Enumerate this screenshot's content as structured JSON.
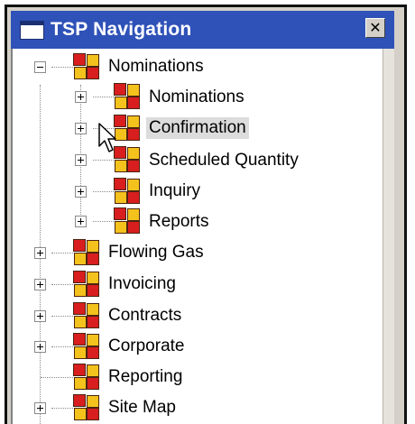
{
  "window": {
    "title": "TSP Navigation",
    "close_glyph": "✕"
  },
  "tree": {
    "root": {
      "label": "Nominations",
      "children": [
        {
          "label": "Nominations"
        },
        {
          "label": "Confirmation",
          "selected": true
        },
        {
          "label": "Scheduled Quantity"
        },
        {
          "label": "Inquiry"
        },
        {
          "label": "Reports"
        }
      ]
    },
    "items": [
      {
        "label": "Flowing Gas"
      },
      {
        "label": "Invoicing"
      },
      {
        "label": "Contracts"
      },
      {
        "label": "Corporate"
      },
      {
        "label": "Reporting"
      },
      {
        "label": "Site Map"
      }
    ]
  },
  "colors": {
    "titlebar": "#2f52b8",
    "icon_red": "#d81e1e",
    "icon_yellow": "#f4c21c",
    "selection": "#dcdcdc"
  },
  "icons": {
    "node": "folder-grid-icon",
    "cursor": "mouse-pointer-icon"
  }
}
